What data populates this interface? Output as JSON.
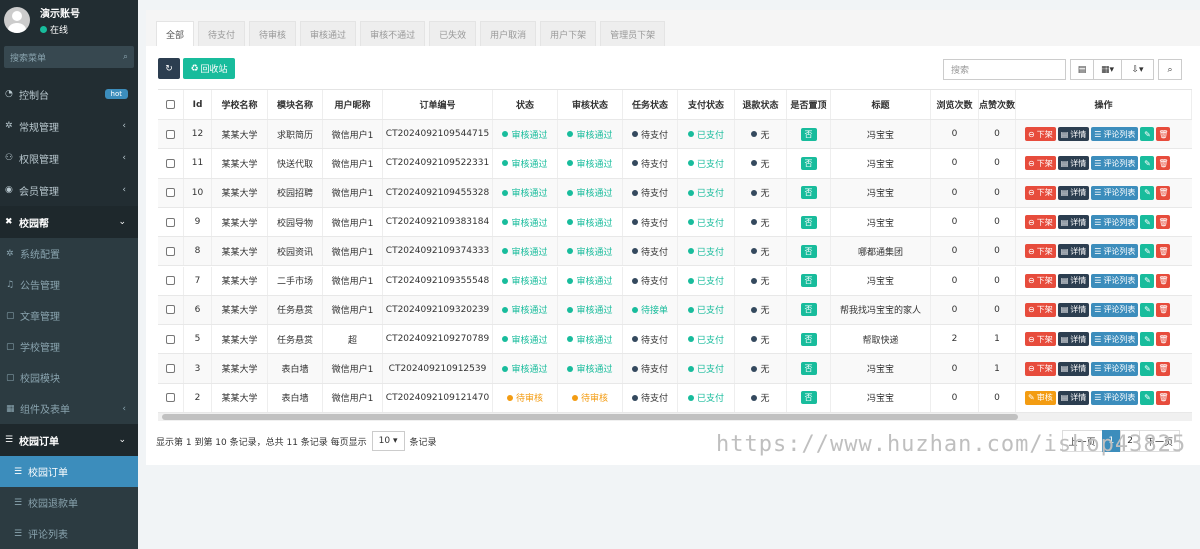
{
  "sidebar": {
    "user_name": "演示账号",
    "user_status": "在线",
    "search_placeholder": "搜索菜单",
    "hot_badge": "hot",
    "items": [
      {
        "label": "控制台",
        "icon": "dashboard-icon"
      },
      {
        "label": "常规管理",
        "icon": "cogs-icon"
      },
      {
        "label": "权限管理",
        "icon": "group-icon"
      },
      {
        "label": "会员管理",
        "icon": "user-icon"
      },
      {
        "label": "校园帮",
        "icon": "tools-icon"
      },
      {
        "label": "系统配置",
        "icon": "cog-icon"
      },
      {
        "label": "公告管理",
        "icon": "bell-icon"
      },
      {
        "label": "文章管理",
        "icon": "file-icon"
      },
      {
        "label": "学校管理",
        "icon": "file-icon"
      },
      {
        "label": "校园模块",
        "icon": "file-icon"
      },
      {
        "label": "组件及表单",
        "icon": "puzzle-icon"
      },
      {
        "label": "校园订单",
        "icon": "list-icon"
      },
      {
        "label": "校园订单",
        "icon": "list-icon"
      },
      {
        "label": "校园退款单",
        "icon": "list-icon"
      },
      {
        "label": "评论列表",
        "icon": "list-icon"
      }
    ]
  },
  "tabs": [
    "全部",
    "待支付",
    "待审核",
    "审核通过",
    "审核不通过",
    "已失效",
    "用户取消",
    "用户下架",
    "管理员下架"
  ],
  "toolbar": {
    "recycle_label": "回收站",
    "search_placeholder": "搜索"
  },
  "table": {
    "headers": [
      "Id",
      "学校名称",
      "模块名称",
      "用户昵称",
      "订单编号",
      "状态",
      "审核状态",
      "任务状态",
      "支付状态",
      "退款状态",
      "是否置顶",
      "标题",
      "浏览次数",
      "点赞次数",
      "操作"
    ],
    "rows": [
      {
        "id": "12",
        "school": "某某大学",
        "module": "求职简历",
        "nick": "微信用户1",
        "order": "CT2024092109544715",
        "status": "审核通过",
        "audit": "审核通过",
        "task": "待支付",
        "pay": "已支付",
        "refund": "无",
        "top": "否",
        "title": "冯宝宝",
        "views": "0",
        "likes": "0",
        "first_op": "下架"
      },
      {
        "id": "11",
        "school": "某某大学",
        "module": "快送代取",
        "nick": "微信用户1",
        "order": "CT2024092109522331",
        "status": "审核通过",
        "audit": "审核通过",
        "task": "待支付",
        "pay": "已支付",
        "refund": "无",
        "top": "否",
        "title": "冯宝宝",
        "views": "0",
        "likes": "0",
        "first_op": "下架"
      },
      {
        "id": "10",
        "school": "某某大学",
        "module": "校园招聘",
        "nick": "微信用户1",
        "order": "CT2024092109455328",
        "status": "审核通过",
        "audit": "审核通过",
        "task": "待支付",
        "pay": "已支付",
        "refund": "无",
        "top": "否",
        "title": "冯宝宝",
        "views": "0",
        "likes": "0",
        "first_op": "下架"
      },
      {
        "id": "9",
        "school": "某某大学",
        "module": "校园导物",
        "nick": "微信用户1",
        "order": "CT2024092109383184",
        "status": "审核通过",
        "audit": "审核通过",
        "task": "待支付",
        "pay": "已支付",
        "refund": "无",
        "top": "否",
        "title": "冯宝宝",
        "views": "0",
        "likes": "0",
        "first_op": "下架"
      },
      {
        "id": "8",
        "school": "某某大学",
        "module": "校园资讯",
        "nick": "微信用户1",
        "order": "CT2024092109374333",
        "status": "审核通过",
        "audit": "审核通过",
        "task": "待支付",
        "pay": "已支付",
        "refund": "无",
        "top": "否",
        "title": "哪都通集团",
        "views": "0",
        "likes": "0",
        "first_op": "下架"
      },
      {
        "id": "7",
        "school": "某某大学",
        "module": "二手市场",
        "nick": "微信用户1",
        "order": "CT2024092109355548",
        "status": "审核通过",
        "audit": "审核通过",
        "task": "待支付",
        "pay": "已支付",
        "refund": "无",
        "top": "否",
        "title": "冯宝宝",
        "views": "0",
        "likes": "0",
        "first_op": "下架"
      },
      {
        "id": "6",
        "school": "某某大学",
        "module": "任务悬赏",
        "nick": "微信用户1",
        "order": "CT2024092109320239",
        "status": "审核通过",
        "audit": "审核通过",
        "task": "待接单",
        "pay": "已支付",
        "refund": "无",
        "top": "否",
        "title": "帮我找冯宝宝的家人",
        "views": "0",
        "likes": "0",
        "first_op": "下架"
      },
      {
        "id": "5",
        "school": "某某大学",
        "module": "任务悬赏",
        "nick": "超",
        "order": "CT2024092109270789",
        "status": "审核通过",
        "audit": "审核通过",
        "task": "待支付",
        "pay": "已支付",
        "refund": "无",
        "top": "否",
        "title": "帮取快递",
        "views": "2",
        "likes": "1",
        "first_op": "下架"
      },
      {
        "id": "3",
        "school": "某某大学",
        "module": "表白墙",
        "nick": "微信用户1",
        "order": "CT202409210912539",
        "status": "审核通过",
        "audit": "审核通过",
        "task": "待支付",
        "pay": "已支付",
        "refund": "无",
        "top": "否",
        "title": "冯宝宝",
        "views": "0",
        "likes": "1",
        "first_op": "下架"
      },
      {
        "id": "2",
        "school": "某某大学",
        "module": "表白墙",
        "nick": "微信用户1",
        "order": "CT2024092109121470",
        "status": "待审核",
        "audit": "待审核",
        "task": "待支付",
        "pay": "已支付",
        "refund": "无",
        "top": "否",
        "title": "冯宝宝",
        "views": "0",
        "likes": "0",
        "first_op": "审核"
      }
    ],
    "op_detail": "详情",
    "op_comments": "评论列表"
  },
  "pager": {
    "summary": "显示第 1 到第 10 条记录，总共 11 条记录 每页显示",
    "per_page": "10",
    "suffix": "条记录",
    "prev": "上一页",
    "page1": "1",
    "page2": "2",
    "next": "下一页"
  },
  "watermark": "https://www.huzhan.com/ishop43825",
  "colors": {
    "sidebar_bg": "#222d32",
    "active_menu": "#3c8dbc",
    "success": "#18bc9c",
    "warning": "#f39c12",
    "danger": "#e74c3c",
    "dark": "#2c3e50",
    "primary": "#3c8dbc",
    "navy": "#34495e"
  }
}
